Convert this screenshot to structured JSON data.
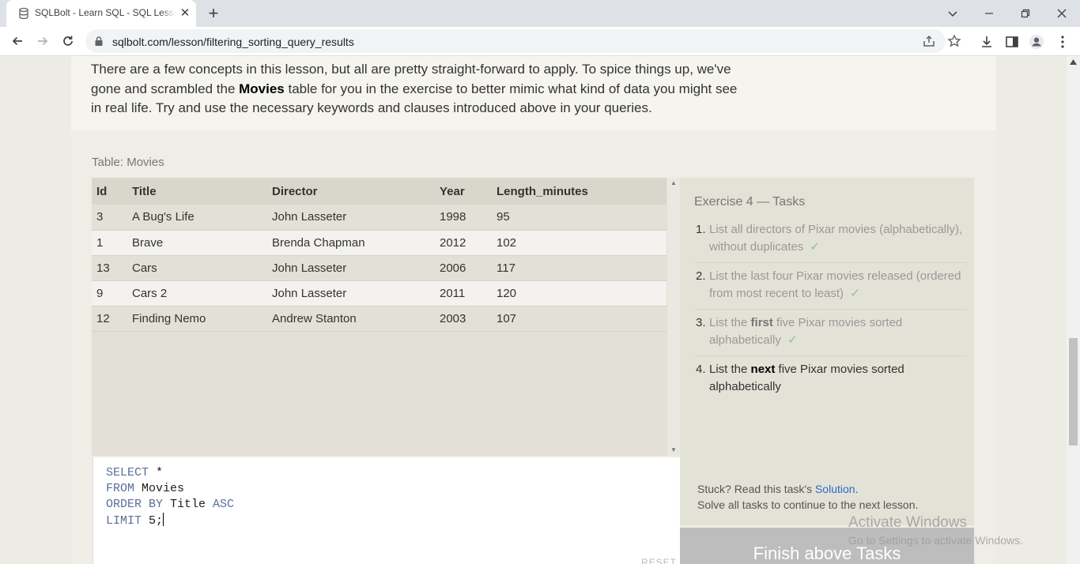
{
  "browser": {
    "tab_title": "SQLBolt - Learn SQL - SQL Lesson",
    "close_glyph": "✕",
    "new_tab_glyph": "+",
    "url": "sqlbolt.com/lesson/filtering_sorting_query_results"
  },
  "intro": {
    "part1": "There are a few concepts in this lesson, but all are pretty straight-forward to apply. To spice things up, we've gone and scrambled the ",
    "bold": "Movies",
    "part2": " table for you in the exercise to better mimic what kind of data you might see in real life. Try and use the necessary keywords and clauses introduced above in your queries."
  },
  "exercise": {
    "table_caption": "Table: Movies",
    "columns": [
      "Id",
      "Title",
      "Director",
      "Year",
      "Length_minutes"
    ],
    "rows": [
      [
        "3",
        "A Bug's Life",
        "John Lasseter",
        "1998",
        "95"
      ],
      [
        "1",
        "Brave",
        "Brenda Chapman",
        "2012",
        "102"
      ],
      [
        "13",
        "Cars",
        "John Lasseter",
        "2006",
        "117"
      ],
      [
        "9",
        "Cars 2",
        "John Lasseter",
        "2011",
        "120"
      ],
      [
        "12",
        "Finding Nemo",
        "Andrew Stanton",
        "2003",
        "107"
      ]
    ],
    "query": {
      "line1_kw": "SELECT",
      "line1_rest": " *",
      "line2_kw": "FROM",
      "line2_rest": " Movies",
      "line3_kw": "ORDER BY",
      "line3_mid": " Title ",
      "line3_kw2": "ASC",
      "line4_kw": "LIMIT",
      "line4_rest": " 5;"
    },
    "reset_label": "RESET",
    "tasks_title": "Exercise 4 — Tasks",
    "tasks": [
      {
        "num": "1.",
        "pre": "List all directors of Pixar movies (alphabetically), without duplicates",
        "bold": "",
        "post": "",
        "done": "✓"
      },
      {
        "num": "2.",
        "pre": "List the last four Pixar movies released (ordered from most recent to least)",
        "bold": "",
        "post": "",
        "done": "✓"
      },
      {
        "num": "3.",
        "pre": "List the ",
        "bold": "first",
        "post": " five Pixar movies sorted alphabetically",
        "done": "✓"
      },
      {
        "num": "4.",
        "pre": "List the ",
        "bold": "next",
        "post": " five Pixar movies sorted alphabetically",
        "done": ""
      }
    ],
    "stuck_prefix": "Stuck? Read this task's ",
    "solution_link": "Solution",
    "stuck_suffix": ".",
    "stuck_line2": "Solve all tasks to continue to the next lesson.",
    "finish_label": "Finish above Tasks"
  },
  "watermark": {
    "line1": "Activate Windows",
    "line2": "Go to Settings to activate Windows."
  },
  "colors": {
    "page_bg": "#ecebe4",
    "keyword": "#5a6e9a",
    "link": "#3366cc",
    "check": "#8dc38d",
    "finish_button": "#bdbdbd"
  }
}
